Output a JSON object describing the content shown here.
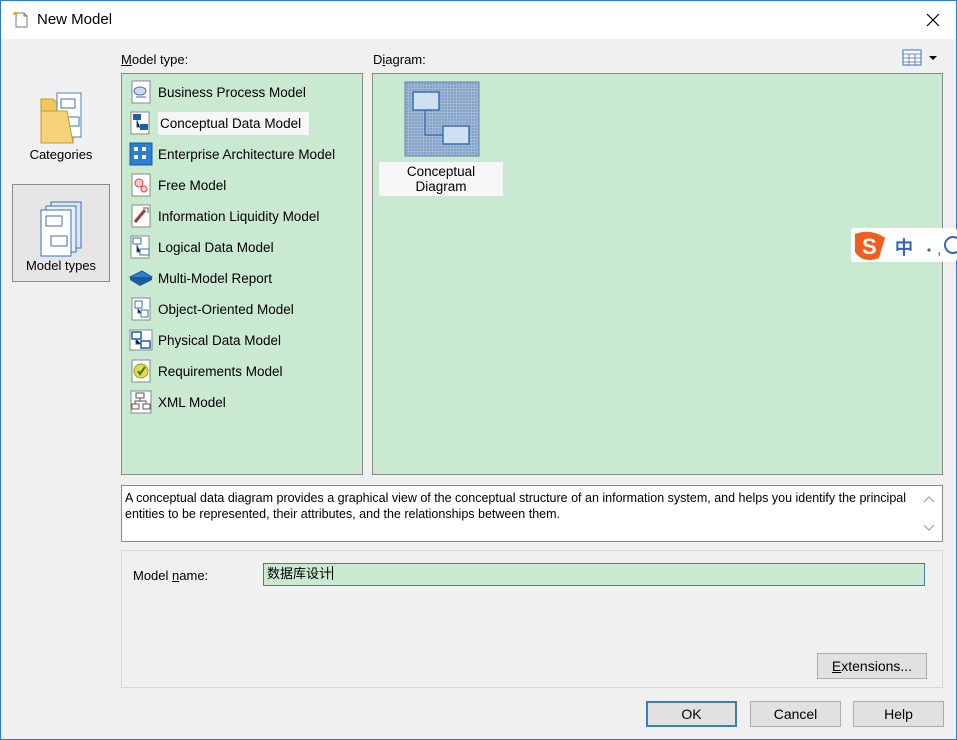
{
  "window": {
    "title": "New Model"
  },
  "categories": {
    "items": [
      {
        "label": "Categories",
        "selected": false
      },
      {
        "label": "Model types",
        "selected": true
      }
    ]
  },
  "model_type": {
    "label_accel": "M",
    "label_rest": "odel type:",
    "items": [
      {
        "label": "Business Process Model",
        "icon": "business-process-icon"
      },
      {
        "label": "Conceptual Data Model",
        "icon": "conceptual-data-icon",
        "selected": true
      },
      {
        "label": "Enterprise Architecture Model",
        "icon": "enterprise-architecture-icon"
      },
      {
        "label": "Free Model",
        "icon": "free-model-icon"
      },
      {
        "label": "Information Liquidity Model",
        "icon": "information-liquidity-icon"
      },
      {
        "label": "Logical Data Model",
        "icon": "logical-data-icon"
      },
      {
        "label": "Multi-Model Report",
        "icon": "multi-model-report-icon"
      },
      {
        "label": "Object-Oriented Model",
        "icon": "object-oriented-icon"
      },
      {
        "label": "Physical Data Model",
        "icon": "physical-data-icon"
      },
      {
        "label": "Requirements Model",
        "icon": "requirements-icon"
      },
      {
        "label": "XML Model",
        "icon": "xml-model-icon"
      }
    ]
  },
  "diagram": {
    "label_pre": "D",
    "label_accel": "i",
    "label_rest": "agram:",
    "items": [
      {
        "label": "Conceptual Diagram",
        "icon": "conceptual-diagram-icon"
      }
    ]
  },
  "description": "A conceptual data diagram provides a graphical view of the conceptual structure of an information system, and helps you identify the principal entities to be represented, their attributes, and the relationships between them.",
  "model_name": {
    "label_pre": "Model ",
    "label_accel": "n",
    "label_rest": "ame:",
    "value": "数据库设计"
  },
  "buttons": {
    "extensions_accel": "E",
    "extensions_rest": "xtensions...",
    "ok": "OK",
    "cancel": "Cancel",
    "help": "Help"
  },
  "ime": {
    "mode": "中"
  },
  "colors": {
    "list_bg": "#c9e9d0",
    "accent": "#3c7fb1"
  }
}
